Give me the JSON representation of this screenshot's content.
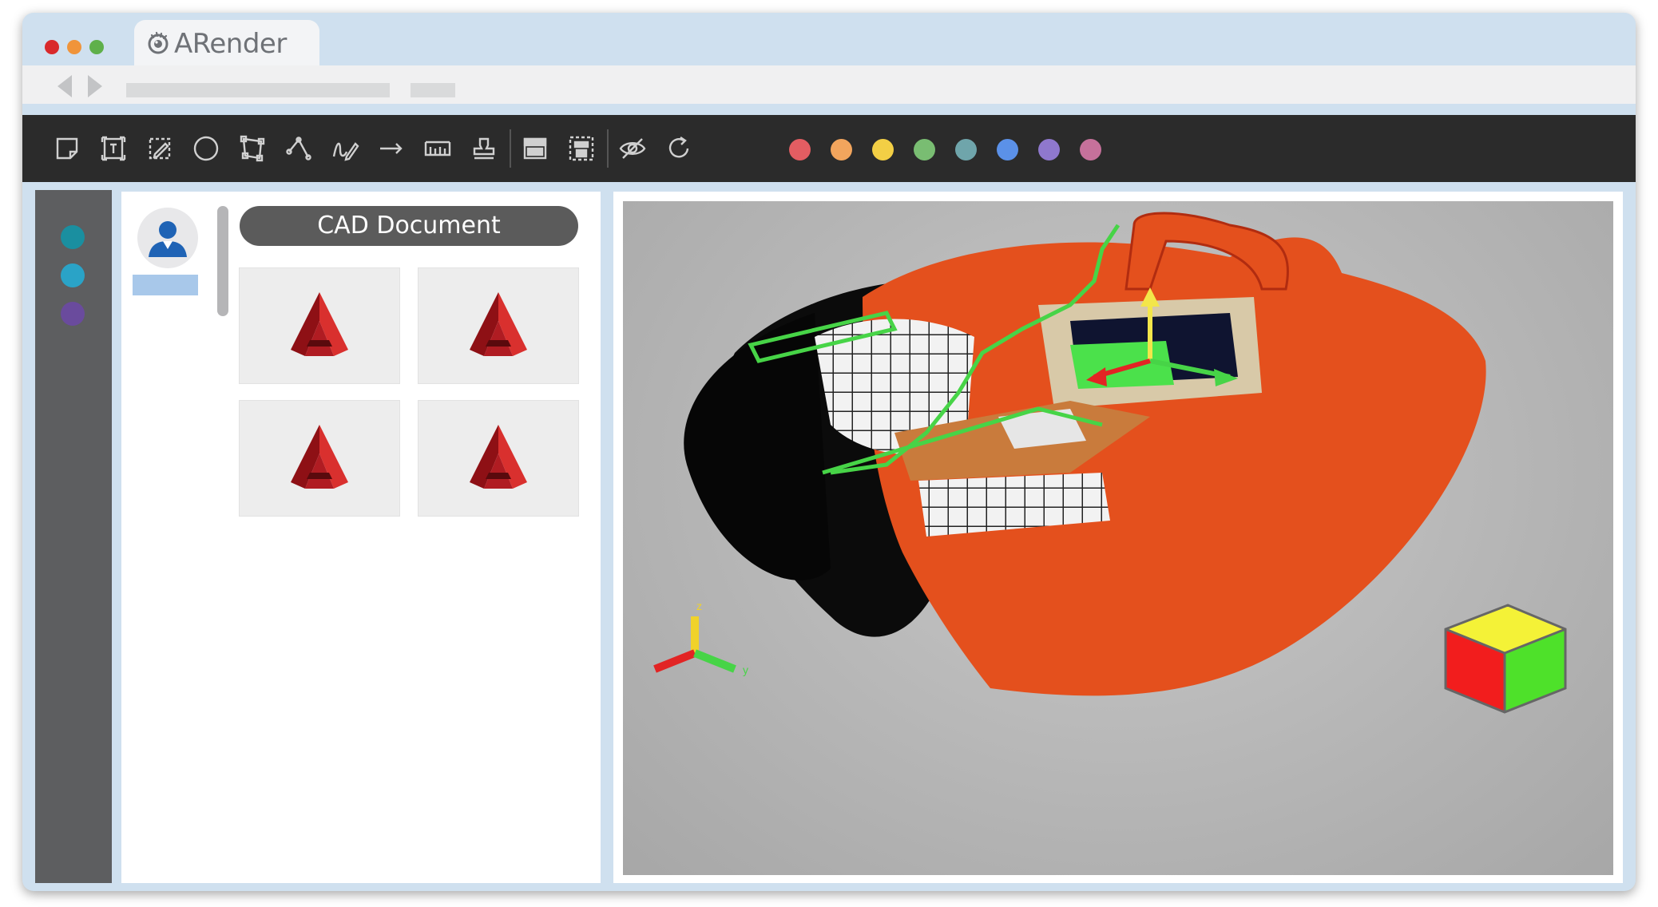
{
  "app": {
    "tab_title": "ARender",
    "logo_icon": "arender-eye-logo-icon"
  },
  "window_controls": {
    "close_color": "#d9292b",
    "minimize_color": "#f0943a",
    "maximize_color": "#5fb04a"
  },
  "toolbar": {
    "tools": [
      "sticky-note-icon",
      "text-box-icon",
      "free-text-icon",
      "circle-icon",
      "polygon-icon",
      "polyline-icon",
      "freehand-pen-icon",
      "arrow-icon",
      "ruler-measure-icon",
      "stamp-icon",
      "redact-area-icon",
      "redact-selection-icon",
      "hide-annotations-icon",
      "rotate-icon"
    ],
    "colors": [
      "#e35d62",
      "#f2a55d",
      "#f3cf45",
      "#79bd72",
      "#6fa5ab",
      "#5b91e8",
      "#8f78cd",
      "#c6719b"
    ]
  },
  "left_rail": {
    "dots": [
      "#1a8fa0",
      "#2aa3c7",
      "#6a4b9d"
    ]
  },
  "document_panel": {
    "title": "CAD Document",
    "avatar_icon": "user-avatar-icon",
    "thumbnails": [
      {
        "icon": "autocad-logo-icon"
      },
      {
        "icon": "autocad-logo-icon"
      },
      {
        "icon": "autocad-logo-icon"
      },
      {
        "icon": "autocad-logo-icon"
      }
    ]
  },
  "viewer": {
    "model": "cad-3d-model-image",
    "axis_labels": {
      "z": "z",
      "y": "y"
    },
    "view_cube_icon": "view-cube-icon"
  }
}
